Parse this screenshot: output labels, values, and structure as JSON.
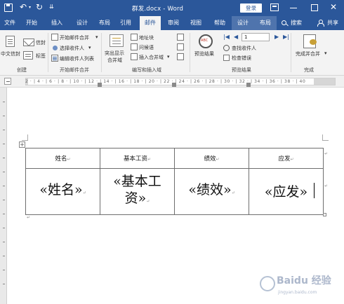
{
  "titlebar": {
    "doc_title": "群发.docx - Word",
    "login_label": "登录",
    "undo_glyph": "↶",
    "undo_dropdown_glyph": "▾",
    "redo_glyph": "↻",
    "customize_glyph": "⇊",
    "close_glyph": "✕"
  },
  "tabs": [
    {
      "label": "文件",
      "active": false,
      "context": false
    },
    {
      "label": "开始",
      "active": false,
      "context": false
    },
    {
      "label": "插入",
      "active": false,
      "context": false
    },
    {
      "label": "设计",
      "active": false,
      "context": false
    },
    {
      "label": "布局",
      "active": false,
      "context": false
    },
    {
      "label": "引用",
      "active": false,
      "context": false
    },
    {
      "label": "邮件",
      "active": true,
      "context": false
    },
    {
      "label": "审阅",
      "active": false,
      "context": false
    },
    {
      "label": "视图",
      "active": false,
      "context": false
    },
    {
      "label": "帮助",
      "active": false,
      "context": false
    },
    {
      "label": "设计",
      "active": false,
      "context": true
    },
    {
      "label": "布局",
      "active": false,
      "context": true
    }
  ],
  "tabs_right": {
    "search_label": "搜索",
    "share_label": "共享"
  },
  "ribbon": {
    "create": {
      "chinese_envelope": "中文信封",
      "envelope": "信封",
      "labels": "标签",
      "group_label": "创建"
    },
    "start_merge": {
      "start_merge": "开始邮件合并",
      "select_recipients": "选择收件人",
      "edit_list": "编辑收件人列表",
      "dropdown_glyph": "▾",
      "group_label": "开始邮件合并"
    },
    "write_insert": {
      "highlight_fields": "突出显示",
      "highlight_fields_2": "合并域",
      "address_block": "地址块",
      "greeting_line": "问候语",
      "insert_field": "插入合并域",
      "group_label": "编写和插入域"
    },
    "preview": {
      "preview_results": "预览结果",
      "record_value": "1",
      "find_recipient": "查找收件人",
      "check_errors": "检查错误",
      "nav_first": "|◀",
      "nav_prev": "◀",
      "nav_next": "▶",
      "nav_last": "▶|",
      "group_label": "预览结果"
    },
    "finish": {
      "finish_merge": "完成并合并",
      "group_label": "完成"
    }
  },
  "ruler": {
    "numbers": "2 · | 4 · | 6 · | 8 · | 10 · | 12 · | 14 · | 16 · | 18 · | 20 · | 22 · | 24 · | 26 · | 28 · | 30 · | 32 · | 34 · | 36 · | 38 · | 40"
  },
  "table": {
    "headers": [
      "姓名",
      "基本工资",
      "绩效",
      "应发"
    ],
    "merge_fields": [
      "«姓名»",
      "«基本工资»",
      "«绩效»",
      "«应发»"
    ],
    "cell_mark": "↵",
    "move_handle": "+"
  },
  "watermark": {
    "brand": "Baidu 经验",
    "sub": "jingyan.baidu.com"
  }
}
